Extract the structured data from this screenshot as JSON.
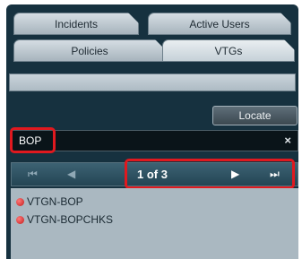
{
  "tabs": {
    "incidents": "Incidents",
    "active_users": "Active Users",
    "policies": "Policies",
    "vtgs": "VTGs"
  },
  "locate_label": "Locate",
  "search": {
    "value": "BOP",
    "clear_symbol": "×"
  },
  "pager": {
    "first": "⏮",
    "prev": "◀",
    "page_indicator": "1 of 3",
    "next": "▶",
    "last": "⏭"
  },
  "results": [
    {
      "label": "VTGN-BOP",
      "status_color": "#d42020"
    },
    {
      "label": "VTGN-BOPCHKS",
      "status_color": "#d42020"
    }
  ],
  "colors": {
    "highlight": "#e0191f",
    "panel_bg": "#16313f",
    "list_bg": "#aab8c1"
  }
}
